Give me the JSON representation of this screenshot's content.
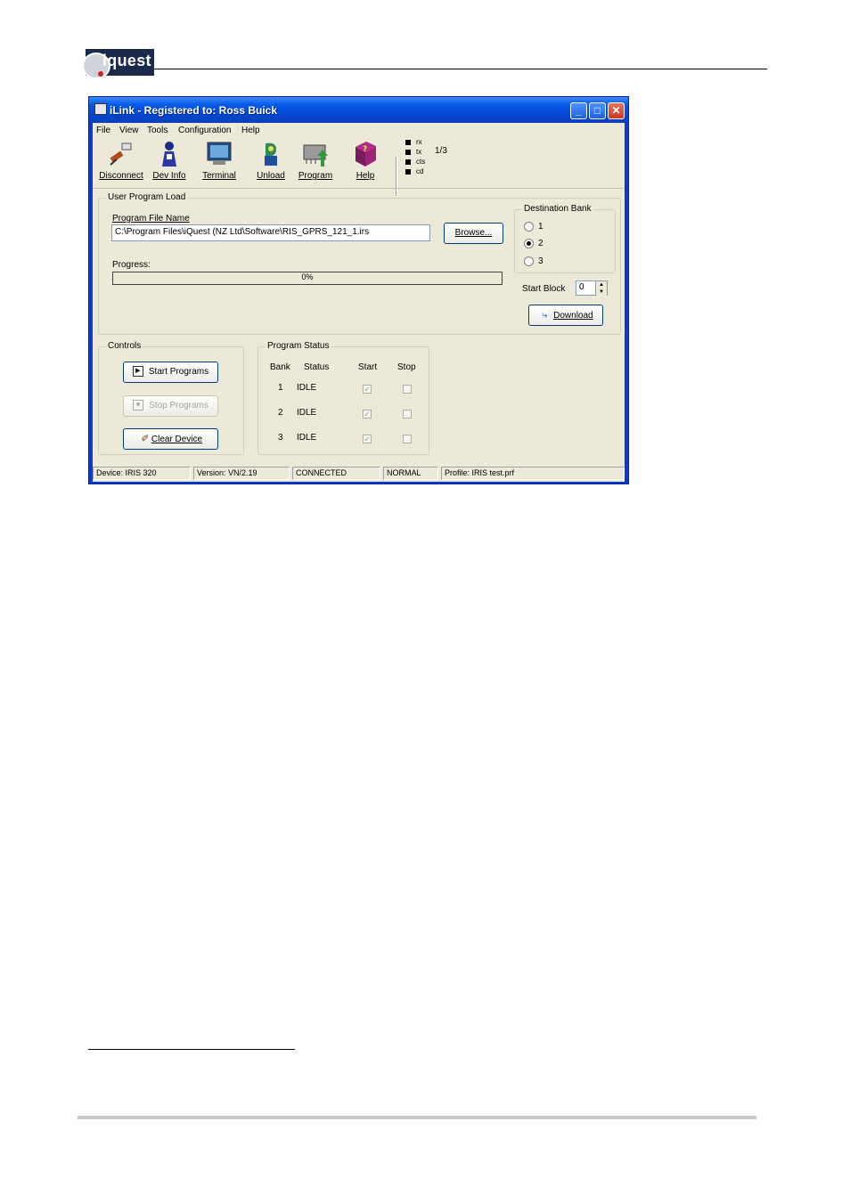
{
  "logo": {
    "text": "iquest"
  },
  "window": {
    "title": "iLink - Registered to: Ross Buick",
    "min_glyph": "_",
    "max_glyph": "□",
    "close_glyph": "✕"
  },
  "menu": [
    "File",
    "View",
    "Tools",
    "Configuration",
    "Help"
  ],
  "toolbar": {
    "buttons": [
      {
        "label": "Disconnect",
        "icon": "disconnect-plug-icon"
      },
      {
        "label": "Dev Info",
        "icon": "person-info-icon"
      },
      {
        "label": "Terminal",
        "icon": "monitor-icon"
      },
      {
        "label": "Unload",
        "icon": "unload-icon"
      },
      {
        "label": "Program",
        "icon": "chip-program-icon"
      },
      {
        "label": "Help",
        "icon": "help-book-icon"
      }
    ],
    "indicators": [
      "rx",
      "tx",
      "cts",
      "cd"
    ],
    "indicator_value": "1/3"
  },
  "upload": {
    "group_caption": "User Program Load",
    "file_label": "Program File Name",
    "file_value": "C:\\Program Files\\iQuest (NZ Ltd\\Software\\RIS_GPRS_121_1.irs",
    "browse_label": "Browse...",
    "progress_label": "Progress:",
    "progress_text": "0%",
    "progress_fraction": 0,
    "dest_caption": "Destination Bank",
    "banks": [
      "1",
      "2",
      "3"
    ],
    "selected_bank": "2",
    "start_block_label": "Start Block",
    "start_block_value": "0",
    "download_label": "Download"
  },
  "controls": {
    "caption": "Controls",
    "start_label": "Start Programs",
    "stop_label": "Stop Programs",
    "clear_label": "Clear Device"
  },
  "program_status": {
    "caption": "Program Status",
    "headers": [
      "Bank",
      "Status",
      "Start",
      "Stop"
    ],
    "rows": [
      {
        "bank": "1",
        "status": "IDLE",
        "start": true,
        "stop": false
      },
      {
        "bank": "2",
        "status": "IDLE",
        "start": true,
        "stop": false
      },
      {
        "bank": "3",
        "status": "IDLE",
        "start": true,
        "stop": false
      }
    ]
  },
  "statusbar": {
    "device": "Device: IRIS 320",
    "version": "Version: VN/2.19",
    "connection": "CONNECTED",
    "mode": "NORMAL",
    "profile": "Profile: IRIS test.prf"
  },
  "colors": {
    "titlebar": "#0545d2",
    "face": "#ece9d8",
    "logo_bg": "#1b2a4a"
  }
}
